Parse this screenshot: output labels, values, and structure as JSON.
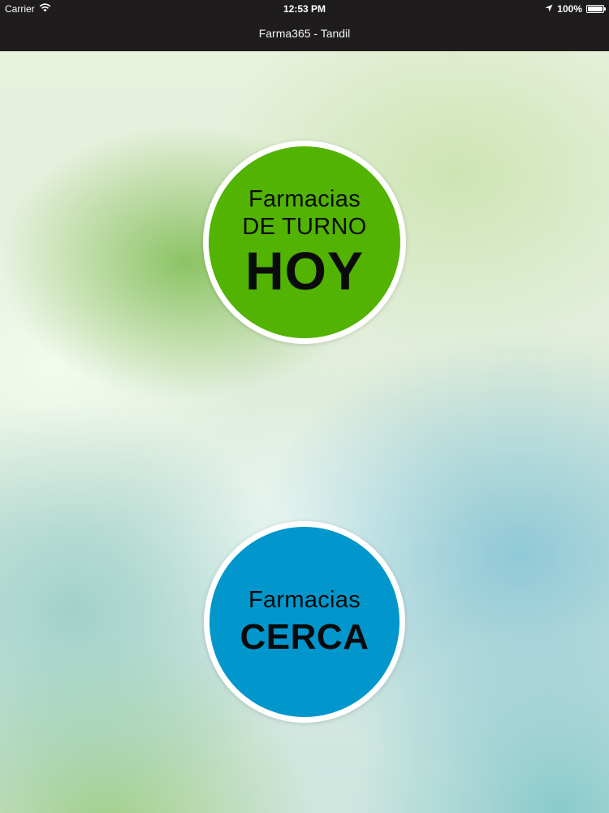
{
  "status_bar": {
    "carrier": "Carrier",
    "time": "12:53 PM",
    "battery": "100%",
    "battery_level": 1.0,
    "icons": [
      "wifi-icon",
      "location-arrow-icon",
      "battery-icon"
    ]
  },
  "nav_bar": {
    "title": "Farma365 - Tandil"
  },
  "buttons": {
    "hoy": {
      "line1": "Farmacias",
      "line2": "DE TURNO",
      "line3": "HOY",
      "color": "#52b302"
    },
    "cerca": {
      "line1": "Farmacias",
      "line2": "CERCA",
      "color": "#0197cc"
    }
  }
}
